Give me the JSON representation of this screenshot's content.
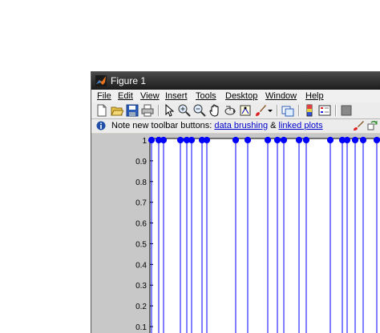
{
  "window": {
    "title": "Figure 1"
  },
  "menu": [
    "File",
    "Edit",
    "View",
    "Insert",
    "Tools",
    "Desktop",
    "Window",
    "Help"
  ],
  "toolbar_icons": [
    "new-figure-icon",
    "open-file-icon",
    "save-icon",
    "print-icon",
    "arrow-icon",
    "zoom-in-icon",
    "zoom-out-icon",
    "pan-icon",
    "rotate-icon",
    "data-cursor-icon",
    "brush-icon",
    "dropdown-icon",
    "link-icon",
    "colorbar-icon",
    "legend-icon",
    "hide-plot-tools-icon"
  ],
  "notice": {
    "prefix": "Note new toolbar buttons: ",
    "link1": "data brushing",
    "amp": " & ",
    "link2": "linked plots"
  },
  "chart_data": {
    "type": "stem",
    "title": "",
    "xlabel": "",
    "ylabel": "",
    "yticks": [
      "1",
      "0.9",
      "0.8",
      "0.7",
      "0.6",
      "0.5",
      "0.4",
      "0.3",
      "0.2",
      "0.1"
    ],
    "ylim": [
      0,
      1
    ],
    "stems": [
      {
        "value": 1
      },
      {
        "value": 1
      },
      {
        "value": 1
      },
      {
        "value": 1
      },
      {
        "value": 1
      },
      {
        "value": 1
      },
      {
        "value": 1
      },
      {
        "value": 1
      },
      {
        "value": 1
      },
      {
        "value": 1
      },
      {
        "value": 1
      },
      {
        "value": 1
      },
      {
        "value": 1
      },
      {
        "value": 1
      },
      {
        "value": 1
      },
      {
        "value": 1
      },
      {
        "value": 1
      },
      {
        "value": 1
      },
      {
        "value": 1
      },
      {
        "value": 1
      },
      {
        "value": 1
      }
    ],
    "grid": false,
    "colors": {
      "stem": "#0000ff"
    }
  }
}
